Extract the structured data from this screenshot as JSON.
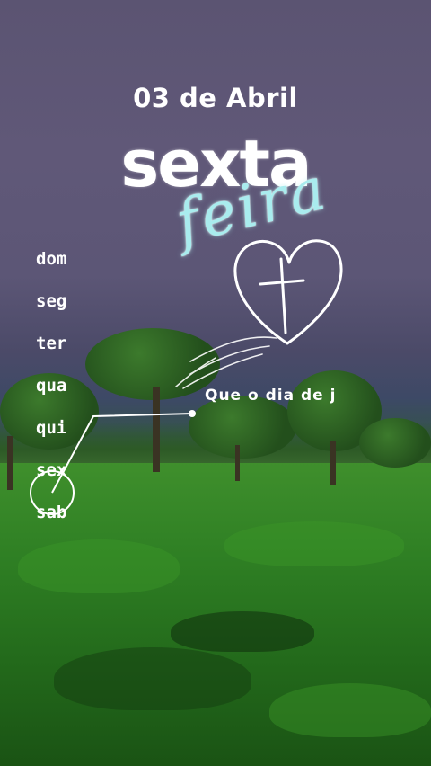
{
  "date_label": "03 de Abril",
  "day_title": "sexta",
  "day_title_script": "feira",
  "weekdays": [
    "dom",
    "seg",
    "ter",
    "qua",
    "qui",
    "sex",
    "sab"
  ],
  "message": "Que o dia de j",
  "icon": "heart-cross-icon",
  "colors": {
    "script_accent": "#a9ecee",
    "text": "#ffffff"
  }
}
